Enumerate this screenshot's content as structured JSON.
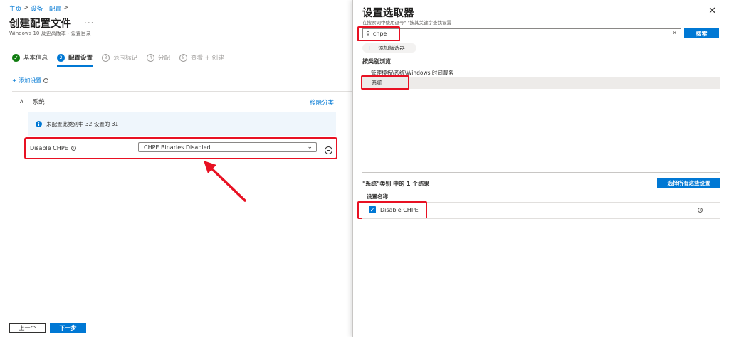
{
  "breadcrumb": {
    "home": "主页",
    "devices": "设备",
    "config": "配置"
  },
  "page": {
    "title": "创建配置文件",
    "more": "...",
    "subtitle": "Windows 10 及更高版本 - 设置目录"
  },
  "steps": [
    {
      "num": "✓",
      "label": "基本信息",
      "state": "done"
    },
    {
      "num": "2",
      "label": "配置设置",
      "state": "active"
    },
    {
      "num": "3",
      "label": "范围标记",
      "state": "future"
    },
    {
      "num": "4",
      "label": "分配",
      "state": "future"
    },
    {
      "num": "5",
      "label": "查看 + 创建",
      "state": "future"
    }
  ],
  "add_setting": {
    "label": "+ 添加设置"
  },
  "section": {
    "name": "系统",
    "remove_category": "移除分类",
    "info": "未配置此类别中 32 设置的 31"
  },
  "setting": {
    "label": "Disable CHPE",
    "value": "CHPE Binaries Disabled"
  },
  "footer": {
    "prev": "上一个",
    "next": "下一步"
  },
  "panel": {
    "title": "设置选取器",
    "hint": "在搜索词中使用逗号\",\"按其关键字查找设置",
    "search_value": "chpe",
    "search_button": "搜索",
    "add_filter": "添加筛选器",
    "browse_label": "按类别浏览",
    "categories": [
      "管理模板\\系统\\Windows 时间服务",
      "系统"
    ],
    "results_label": "\"系统\"类别 中的 1 个结果",
    "select_all": "选择所有这些设置",
    "column_header": "设置名称",
    "results": [
      {
        "name": "Disable CHPE",
        "checked": true
      }
    ]
  },
  "colors": {
    "accent": "#0078d4",
    "highlight": "#e81123",
    "done": "#107c10"
  }
}
